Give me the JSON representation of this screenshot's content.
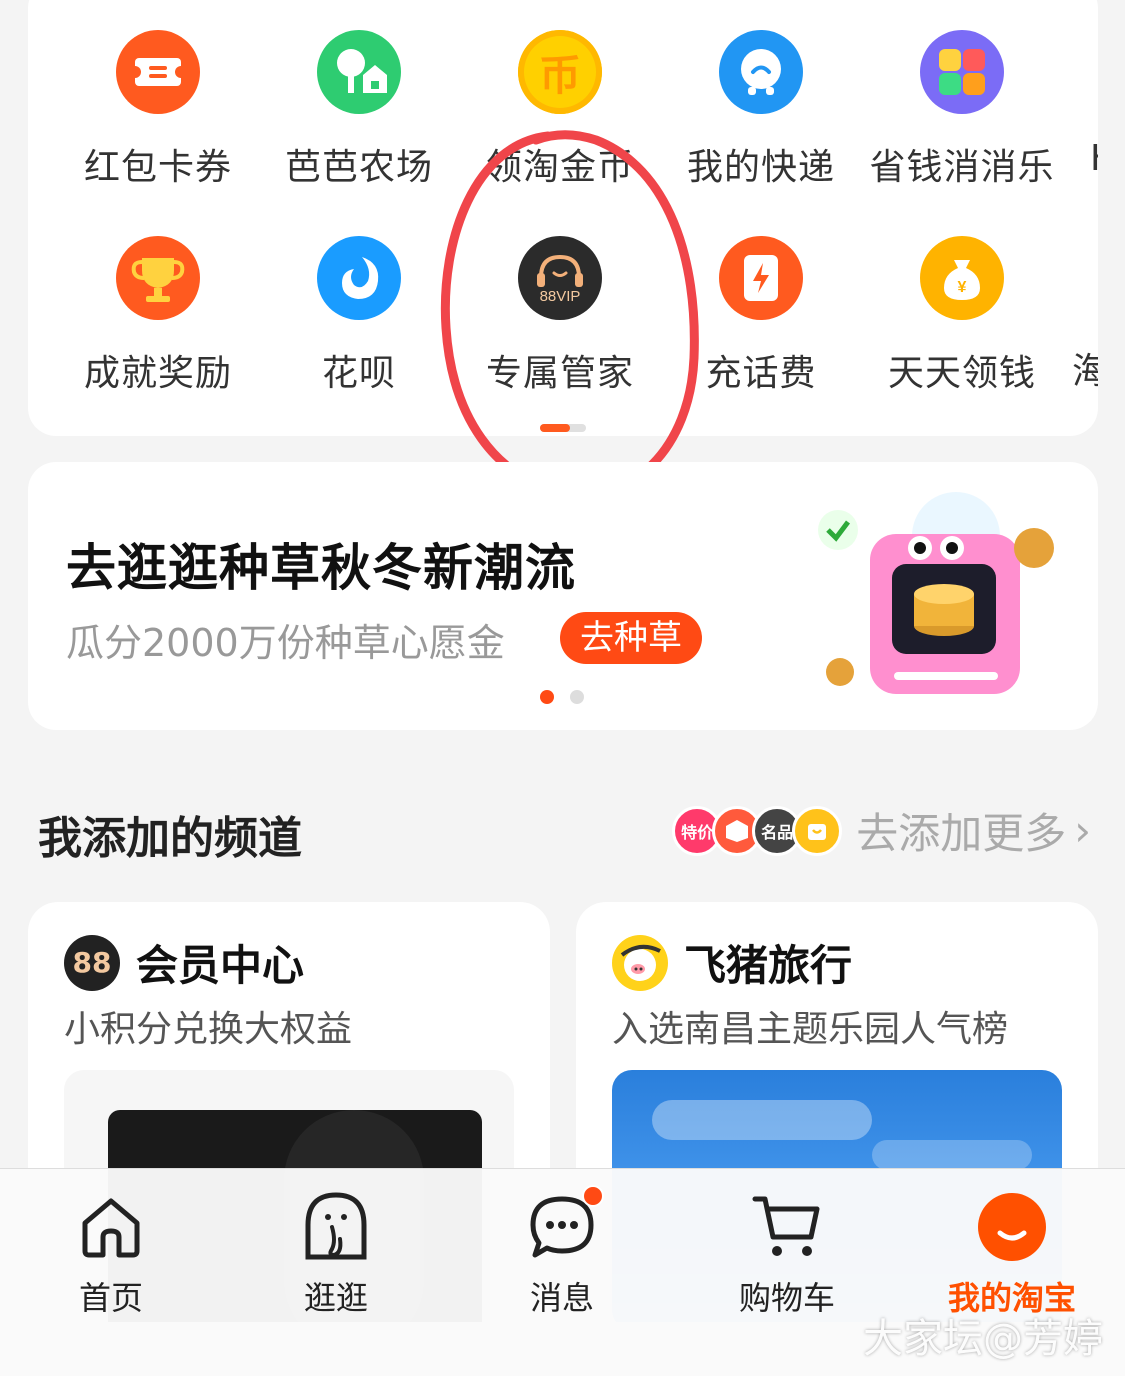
{
  "grid": {
    "row1": [
      {
        "label": "红包卡券",
        "icon": "ticket-icon",
        "color": "#ff5a1f"
      },
      {
        "label": "芭芭农场",
        "icon": "farm-tree-icon",
        "color": "#2ecc71"
      },
      {
        "label": "领淘金币",
        "icon": "coin-icon",
        "color": "#ffcc00"
      },
      {
        "label": "我的快递",
        "icon": "courier-icon",
        "color": "#2196f3"
      },
      {
        "label": "省钱消消乐",
        "icon": "puzzle-game-icon",
        "color": "#7b6cf6"
      }
    ],
    "row1_partial": "H",
    "row2": [
      {
        "label": "成就奖励",
        "icon": "trophy-icon",
        "color": "#ff5a1f"
      },
      {
        "label": "花呗",
        "icon": "huabei-icon",
        "color": "#1a9cff"
      },
      {
        "label": "专属管家",
        "icon": "headset-88vip-icon",
        "color": "#2b2b2b",
        "badge": "88VIP"
      },
      {
        "label": "充话费",
        "icon": "phone-charge-icon",
        "color": "#ff5a1f"
      },
      {
        "label": "天天领钱",
        "icon": "money-bag-icon",
        "color": "#ffb300"
      }
    ],
    "row2_partial": "海"
  },
  "banner": {
    "title": "去逛逛种草秋冬新潮流",
    "subtitle": "瓜分2000万份种草心愿金",
    "button": "去种草"
  },
  "channels": {
    "title": "我添加的频道",
    "more": "去添加更多",
    "mini_icons": [
      "特价",
      "",
      "名品",
      ""
    ],
    "cards": [
      {
        "name": "会员中心",
        "desc": "小积分兑换大权益",
        "logo_text": "88"
      },
      {
        "name": "飞猪旅行",
        "desc": "入选南昌主题乐园人气榜"
      }
    ]
  },
  "tabbar": {
    "tabs": [
      {
        "label": "首页",
        "icon": "home-icon"
      },
      {
        "label": "逛逛",
        "icon": "explore-icon"
      },
      {
        "label": "消息",
        "icon": "message-icon"
      },
      {
        "label": "购物车",
        "icon": "cart-icon"
      },
      {
        "label": "我的淘宝",
        "icon": "my-taobao-icon",
        "active": true
      }
    ]
  },
  "watermark": "大家坛@芳婷",
  "colors": {
    "accent": "#ff5000",
    "annotation": "#f0454a"
  }
}
